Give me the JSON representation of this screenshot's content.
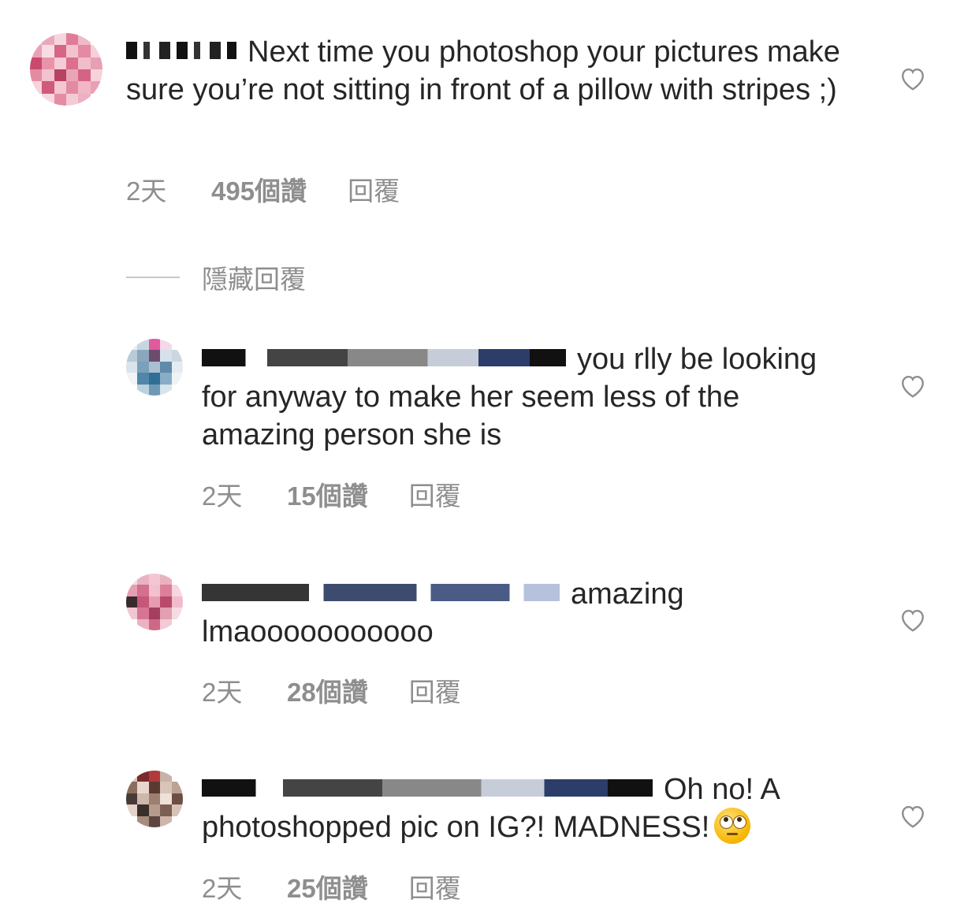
{
  "comments": [
    {
      "text": "Next time you photoshop your pictures make sure you’re not sitting in front of a pillow with stripes ;)",
      "time": "2天",
      "likes": "495個讚",
      "reply": "回覆"
    },
    {
      "text": "you rlly be looking for anyway to make her seem less of the amazing person she is",
      "time": "2天",
      "likes": "15個讚",
      "reply": "回覆"
    },
    {
      "text": "amazing lmaooooooooooo",
      "time": "2天",
      "likes": "28個讚",
      "reply": "回覆"
    },
    {
      "text": "Oh no! A photoshopped pic on IG?! MADNESS!",
      "time": "2天",
      "likes": "25個讚",
      "reply": "回覆"
    }
  ],
  "hide_replies_label": "隱藏回覆",
  "icons": {
    "heart": "heart-outline-icon",
    "emoji": "face-with-rolling-eyes-emoji"
  },
  "colors": {
    "text": "#262626",
    "meta": "#8e8e8e",
    "divider": "#c7c7c7"
  }
}
